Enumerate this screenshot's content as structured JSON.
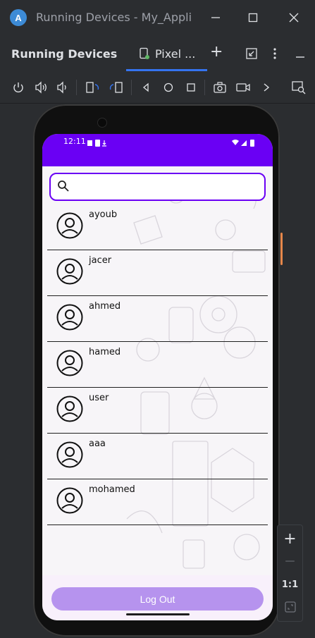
{
  "window": {
    "title": "Running Devices - My_Applic",
    "controls": [
      "minimize",
      "maximize",
      "close"
    ]
  },
  "tool_window": {
    "title": "Running Devices",
    "tab_label": "Pixel ...",
    "add_tab": "+"
  },
  "toolbar": {
    "buttons": [
      "power-icon",
      "volume-up-icon",
      "volume-down-icon",
      "rotate-left-icon",
      "rotate-right-icon",
      "back-icon",
      "home-icon",
      "overview-icon",
      "screenshot-icon",
      "screen-record-icon",
      "more-icon",
      "device-search-icon"
    ]
  },
  "device": {
    "status_time": "12:11",
    "search_placeholder": "",
    "users": [
      "ayoub",
      "jacer",
      "ahmed",
      "hamed",
      "user",
      "aaa",
      "mohamed"
    ],
    "logout_label": "Log Out",
    "accent": "#6a00f4",
    "button_color": "#b693ee"
  },
  "zoom": {
    "zoom_in": "+",
    "zoom_out": "—",
    "actual_size": "1:1"
  }
}
